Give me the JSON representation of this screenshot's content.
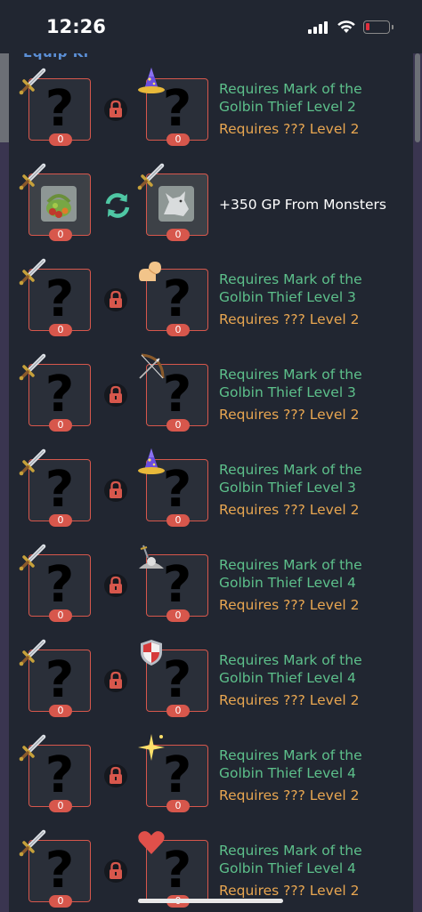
{
  "status_bar": {
    "time": "12:26",
    "battery_color": "#e0303d"
  },
  "peek_header": "Equip Ki",
  "colors": {
    "border": "#d7574c",
    "requirement_green": "#5dc08b",
    "requirement_orange": "#e8a651",
    "panel": "#212631"
  },
  "rows": [
    {
      "locked": true,
      "icon2": "wizard-hat-icon",
      "quantity_1": "0",
      "quantity_2": "0",
      "requirement": "Requires Mark of the Golbin Thief Level 2",
      "requirement_2": "Requires ??? Level 2"
    },
    {
      "locked": false,
      "icon2": "sword-icon",
      "quantity_1": "0",
      "quantity_2": "0",
      "bonus": "+350 GP From Monsters",
      "item_1": "herb-basket",
      "item_2": "wolf"
    },
    {
      "locked": true,
      "icon2": "flexed-arm-icon",
      "quantity_1": "0",
      "quantity_2": "0",
      "requirement": "Requires Mark of the Golbin Thief Level 3",
      "requirement_2": "Requires ??? Level 2"
    },
    {
      "locked": true,
      "icon2": "bow-icon",
      "quantity_1": "0",
      "quantity_2": "0",
      "requirement": "Requires Mark of the Golbin Thief Level 3",
      "requirement_2": "Requires ??? Level 2"
    },
    {
      "locked": true,
      "icon2": "wizard-hat-icon",
      "quantity_1": "0",
      "quantity_2": "0",
      "requirement": "Requires Mark of the Golbin Thief Level 3",
      "requirement_2": "Requires ??? Level 2"
    },
    {
      "locked": true,
      "icon2": "slayer-skull-icon",
      "quantity_1": "0",
      "quantity_2": "0",
      "requirement": "Requires Mark of the Golbin Thief Level 4",
      "requirement_2": "Requires ??? Level 2"
    },
    {
      "locked": true,
      "icon2": "shield-icon",
      "quantity_1": "0",
      "quantity_2": "0",
      "requirement": "Requires Mark of the Golbin Thief Level 4",
      "requirement_2": "Requires ??? Level 2"
    },
    {
      "locked": true,
      "icon2": "sparkle-icon",
      "quantity_1": "0",
      "quantity_2": "0",
      "requirement": "Requires Mark of the Golbin Thief Level 4",
      "requirement_2": "Requires ??? Level 2"
    },
    {
      "locked": true,
      "icon2": "heart-icon",
      "quantity_1": "0",
      "quantity_2": "0",
      "requirement": "Requires Mark of the Golbin Thief Level 4",
      "requirement_2": "Requires ??? Level 2"
    }
  ]
}
